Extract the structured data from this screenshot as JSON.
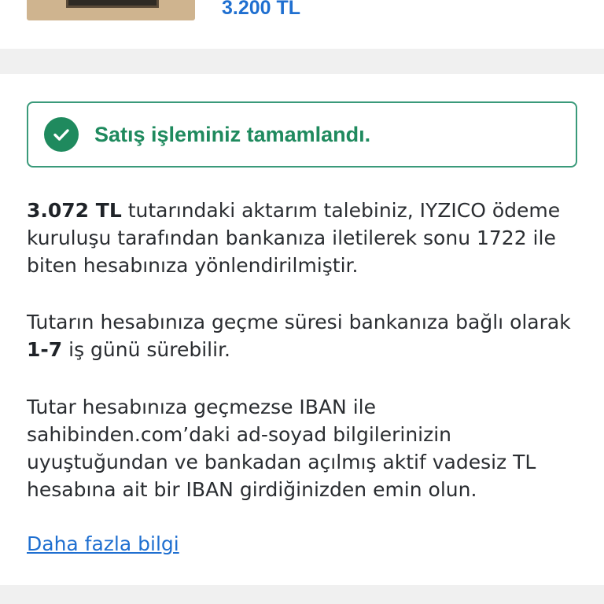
{
  "listing": {
    "price": "3.200 TL"
  },
  "success": {
    "message": "Satış işleminiz tamamlandı."
  },
  "info": {
    "p1_amount": "3.072 TL",
    "p1_rest": " tutarındaki aktarım talebiniz, IYZICO ödeme kuruluşu tarafından bankanıza iletilerek sonu 1722 ile biten hesabınıza yönlendirilmiştir.",
    "p2_before": "Tutarın hesabınıza geçme süresi bankanıza bağlı olarak ",
    "p2_bold": "1-7",
    "p2_after": " iş günü sürebilir.",
    "p3": "Tutar hesabınıza geçmezse IBAN ile sahibinden.com’daki ad-soyad bilgilerinizin uyuştuğundan ve bankadan açılmış aktif vadesiz TL hesabına ait bir IBAN girdiğinizden emin olun."
  },
  "links": {
    "more_info": "Daha fazla bilgi"
  },
  "colors": {
    "accent_blue": "#1f6fd0",
    "success_green": "#1f8a5e",
    "border_green": "#3a9a7a",
    "band_gray": "#f0f0f0"
  }
}
